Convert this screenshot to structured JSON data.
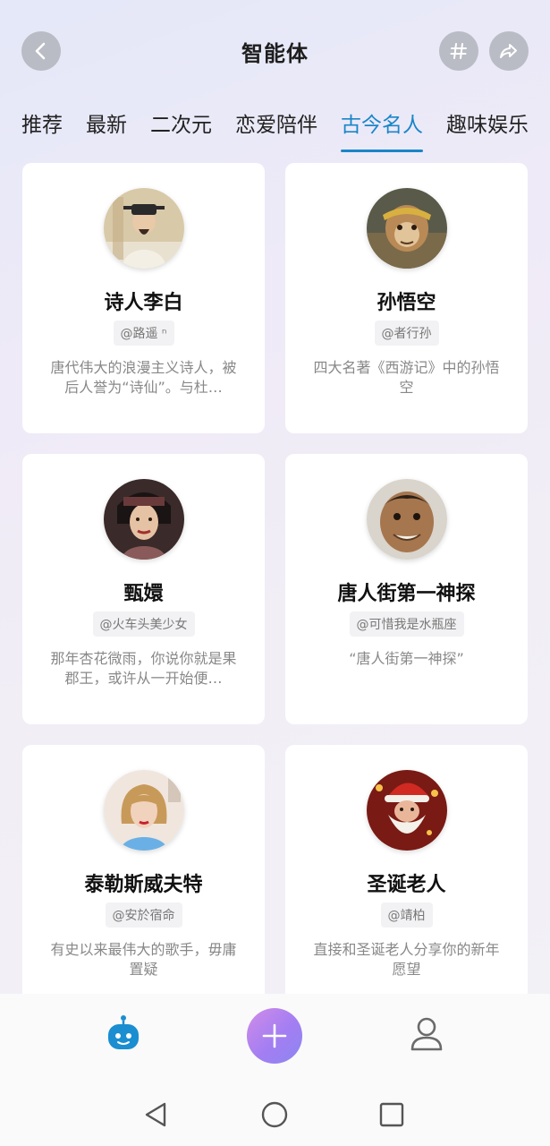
{
  "header": {
    "title": "智能体",
    "back_icon": "chevron-left-icon",
    "hash_icon": "hashtag-icon",
    "share_icon": "share-icon"
  },
  "tabs": [
    {
      "label": "推荐",
      "active": false
    },
    {
      "label": "最新",
      "active": false
    },
    {
      "label": "二次元",
      "active": false
    },
    {
      "label": "恋爱陪伴",
      "active": false
    },
    {
      "label": "古今名人",
      "active": true
    },
    {
      "label": "趣味娱乐",
      "active": false
    }
  ],
  "cards": [
    {
      "name": "诗人李白",
      "handle": "@路遥 ⁿ",
      "desc": "唐代伟大的浪漫主义诗人，被后人誉为“诗仙”。与杜…",
      "avatar": "li-bai-portrait"
    },
    {
      "name": "孙悟空",
      "handle": "@者行孙",
      "desc": "四大名著《西游记》中的孙悟空",
      "avatar": "sun-wukong-portrait"
    },
    {
      "name": "甄嬛",
      "handle": "@火车头美少女",
      "desc": "那年杏花微雨，你说你就是果郡王，或许从一开始便…",
      "avatar": "zhen-huan-portrait"
    },
    {
      "name": "唐人街第一神探",
      "handle": "@可惜我是水瓶座",
      "desc": "“唐人街第一神探”",
      "avatar": "detective-portrait"
    },
    {
      "name": "泰勒斯威夫特",
      "handle": "@安於宿命",
      "desc": "有史以来最伟大的歌手，毋庸置疑",
      "avatar": "taylor-swift-portrait"
    },
    {
      "name": "圣诞老人",
      "handle": "@靖柏",
      "desc": "直接和圣诞老人分享你的新年愿望",
      "avatar": "santa-claus-portrait"
    }
  ],
  "bottom_nav": {
    "items": [
      "robot-icon",
      "plus-icon",
      "profile-icon"
    ]
  },
  "colors": {
    "accent": "#1a86c8",
    "add_button_gradient_start": "#d08ce8",
    "add_button_gradient_end": "#8d86f0"
  }
}
